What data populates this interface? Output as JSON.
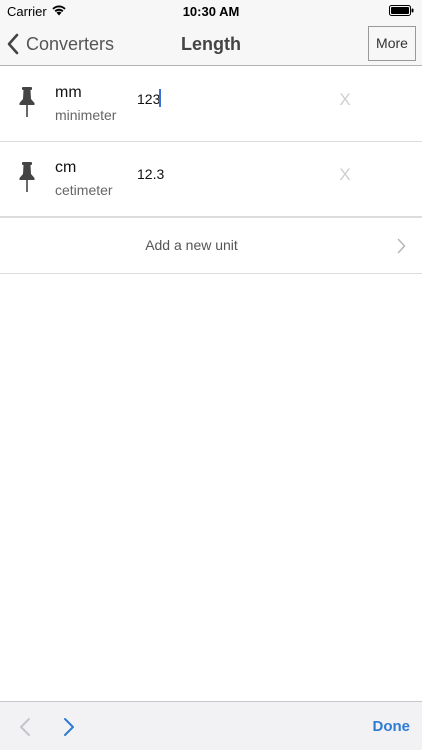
{
  "status_bar": {
    "carrier": "Carrier",
    "time": "10:30 AM"
  },
  "nav": {
    "back_label": "Converters",
    "title": "Length",
    "more_label": "More"
  },
  "units": [
    {
      "abbr": "mm",
      "name": "minimeter",
      "value": "123",
      "clear": "X"
    },
    {
      "abbr": "cm",
      "name": "cetimeter",
      "value": "12.3",
      "clear": "X"
    }
  ],
  "add_unit": {
    "label": "Add a new unit"
  },
  "toolbar": {
    "done_label": "Done"
  },
  "colors": {
    "accent": "#2f7bd2",
    "caret": "#3a6fd8"
  },
  "icons": [
    "wifi-icon",
    "battery-icon",
    "back-chevron-icon",
    "pin-icon",
    "clear-icon",
    "chevron-right-icon",
    "prev-arrow-icon",
    "next-arrow-icon"
  ]
}
